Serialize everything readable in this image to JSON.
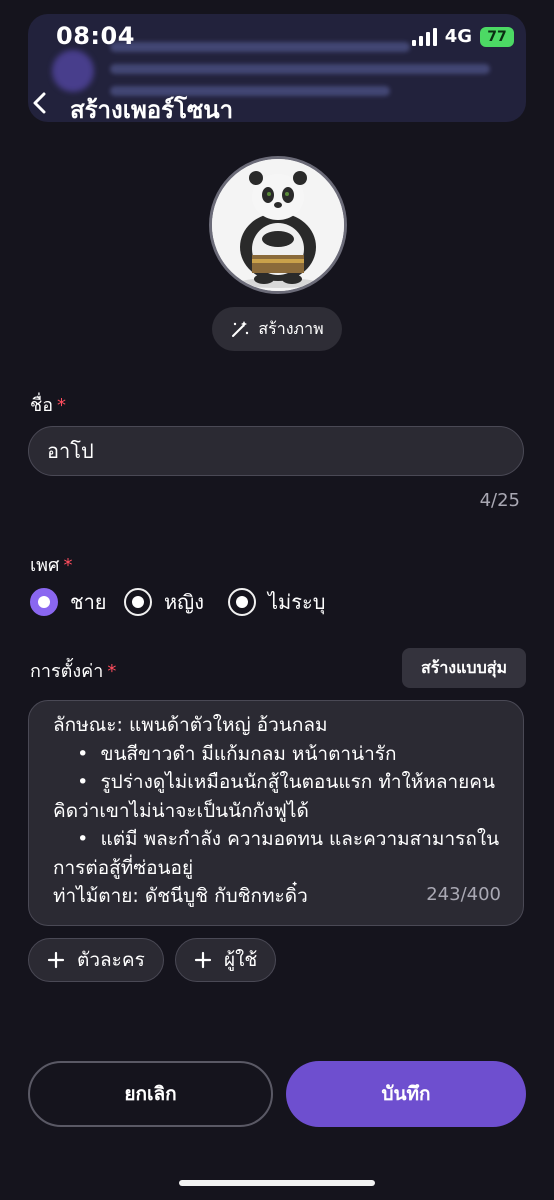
{
  "status_bar": {
    "time": "08:04",
    "network": "4G",
    "battery": "77"
  },
  "header": {
    "title": "สร้างเพอร์โซนา"
  },
  "avatar": {
    "generate_label": "สร้างภาพ"
  },
  "name": {
    "label": "ชื่อ",
    "required_mark": "*",
    "value": "อาโป",
    "counter": "4/25"
  },
  "gender": {
    "label": "เพศ",
    "required_mark": "*",
    "options": [
      "ชาย",
      "หญิง",
      "ไม่ระบุ"
    ],
    "selected": "ชาย"
  },
  "settings": {
    "label": "การตั้งค่า",
    "required_mark": "*",
    "random_label": "สร้างแบบสุ่ม",
    "text": "ลักษณะ: แพนด้าตัวใหญ่ อ้วนกลม\n    •  ขนสีขาวดำ มีแก้มกลม หน้าตาน่ารัก\n    •  รูปร่างดูไม่เหมือนนักสู้ในตอนแรก ทำให้หลายคนคิดว่าเขาไม่น่าจะเป็นนักกังฟูได้\n    •  แต่มี พละกำลัง ความอดทน และความสามารถในการต่อสู้ที่ซ่อนอยู่\nท่าไม้ตาย: ดัชนีบูชิ กับชิกทะดิ๋ว",
    "counter": "243/400"
  },
  "chips": [
    {
      "icon": "plus-icon",
      "label": "ตัวละคร"
    },
    {
      "icon": "plus-icon",
      "label": "ผู้ใช้"
    }
  ],
  "actions": {
    "cancel": "ยกเลิก",
    "save": "บันทึก"
  },
  "colors": {
    "accent": "#6e4fcf",
    "radio_selected": "#8a67f0",
    "required": "#ff4d5e",
    "background": "#15141d"
  }
}
